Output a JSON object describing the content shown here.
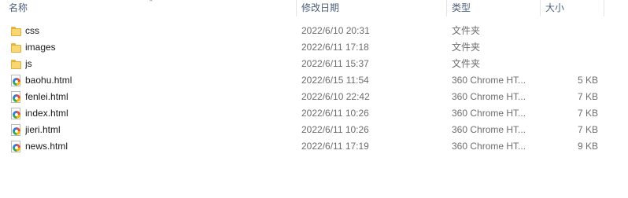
{
  "columns": {
    "name": "名称",
    "date": "修改日期",
    "type": "类型",
    "size": "大小"
  },
  "files": [
    {
      "name": "css",
      "date": "2022/6/10 20:31",
      "type": "文件夹",
      "size": "",
      "icon": "folder-icon"
    },
    {
      "name": "images",
      "date": "2022/6/11 17:18",
      "type": "文件夹",
      "size": "",
      "icon": "folder-icon"
    },
    {
      "name": "js",
      "date": "2022/6/11 15:37",
      "type": "文件夹",
      "size": "",
      "icon": "folder-icon"
    },
    {
      "name": "baohu.html",
      "date": "2022/6/15 11:54",
      "type": "360 Chrome HT...",
      "size": "5 KB",
      "icon": "html-file-icon"
    },
    {
      "name": "fenlei.html",
      "date": "2022/6/10 22:42",
      "type": "360 Chrome HT...",
      "size": "7 KB",
      "icon": "html-file-icon"
    },
    {
      "name": "index.html",
      "date": "2022/6/11 10:26",
      "type": "360 Chrome HT...",
      "size": "7 KB",
      "icon": "html-file-icon"
    },
    {
      "name": "jieri.html",
      "date": "2022/6/11 10:26",
      "type": "360 Chrome HT...",
      "size": "7 KB",
      "icon": "html-file-icon"
    },
    {
      "name": "news.html",
      "date": "2022/6/11 17:19",
      "type": "360 Chrome HT...",
      "size": "9 KB",
      "icon": "html-file-icon"
    }
  ]
}
